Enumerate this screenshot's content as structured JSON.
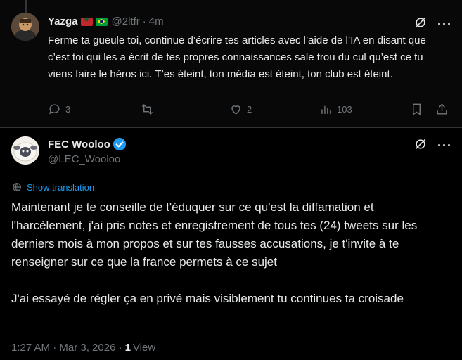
{
  "reply": {
    "name": "Yazga",
    "handle": "@2ltfr",
    "separator": "·",
    "time": "4m",
    "text": "Ferme ta gueule toi, continue d’écrire tes articles avec l’aide de l’IA en disant que c’est toi qui les a écrit de tes propres connaissances sale trou du cul qu’est ce tu viens faire le héros ici. T’es éteint, ton média est éteint, ton club est éteint.",
    "counts": {
      "replies": "3",
      "likes": "2",
      "views": "103"
    }
  },
  "main": {
    "name": "FEC Wooloo",
    "handle": "@LEC_Wooloo",
    "show_translation": "Show translation",
    "text": "Maintenant je te conseille de t'éduquer sur ce qu'est la diffamation et l'harcèlement, j'ai pris notes et enregistrement de tous tes (24) tweets sur les derniers mois à mon propos et sur tes fausses accusations, je t'invite à te renseigner sur ce que la france permets à ce sujet\n\nJ'ai essayé de régler ça en privé mais visiblement tu continues ta croisade",
    "timestamp": "1:27 AM · Mar 3, 2026 ·",
    "view_count": "1",
    "view_label": "View"
  },
  "icons": [
    "grok-icon",
    "more-icon",
    "reply-icon",
    "retweet-icon",
    "like-icon",
    "views-icon",
    "bookmark-icon",
    "share-icon",
    "globe-icon",
    "verified-badge-icon"
  ],
  "colors": {
    "background": "#000000",
    "text": "#e7e9ea",
    "muted": "#71767b",
    "accent": "#1d9bf0"
  }
}
